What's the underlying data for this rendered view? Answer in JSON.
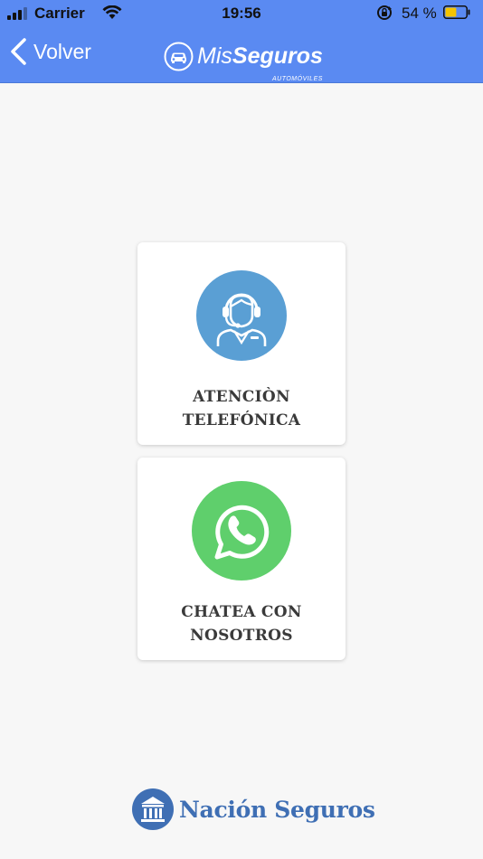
{
  "status_bar": {
    "carrier": "Carrier",
    "time": "19:56",
    "battery_percent": "54 %",
    "battery_level": 0.54,
    "icons": [
      "signal-icon",
      "wifi-icon",
      "rotation-lock-icon",
      "battery-icon"
    ]
  },
  "nav": {
    "back_label": "Volver",
    "logo": {
      "light": "Mis",
      "bold": "Seguros",
      "subtitle": "AUTOMÓVILES"
    }
  },
  "cards": [
    {
      "label_lines": [
        "ATENCIÒN",
        "TELEFÓNICA"
      ],
      "icon": "call-center-agent-icon",
      "color": "#5a9fd4"
    },
    {
      "label_lines": [
        "CHATEA CON",
        "NOSOTROS"
      ],
      "icon": "whatsapp-icon",
      "color": "#5fcf6c"
    }
  ],
  "footer": {
    "brand": "Nación Seguros",
    "icon": "bank-building-icon"
  },
  "colors": {
    "header": "#5a8af2",
    "background": "#f7f7f7",
    "footer_brand": "#3f6fb4",
    "label_text": "#3a3a3a"
  }
}
